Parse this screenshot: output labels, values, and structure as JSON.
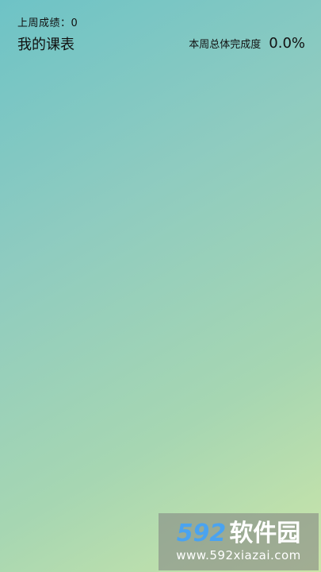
{
  "header": {
    "last_week_score": "上周成绩：0",
    "title": "我的课表",
    "completion_label": "本周总体完成度",
    "completion_value": "0.0%"
  },
  "watermark": {
    "brand_number": "592",
    "brand_text": "软件园",
    "url": "www.592xiazai.com"
  },
  "colors": {
    "gradient_start": "#6ec3c6",
    "gradient_end": "#cbe5a9",
    "watermark_accent": "#4aa3f0"
  }
}
